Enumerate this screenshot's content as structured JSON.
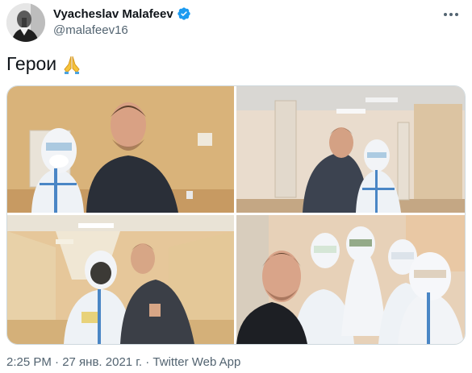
{
  "author": {
    "name": "Vyacheslav Malafeev",
    "handle": "@malafeev16",
    "verified": true,
    "avatar_icon": "avatar-photo"
  },
  "tweet": {
    "text": "Герои",
    "emoji": "folded-hands-icon",
    "timestamp": "2:25 PM · 27 янв. 2021 г. · Twitter Web App"
  },
  "media": {
    "count": 4,
    "photos": [
      "photo-1",
      "photo-2",
      "photo-3",
      "photo-4"
    ]
  },
  "colors": {
    "text": "#0f1419",
    "secondary": "#536471",
    "verified": "#1d9bf0",
    "border": "#cfd9de"
  }
}
